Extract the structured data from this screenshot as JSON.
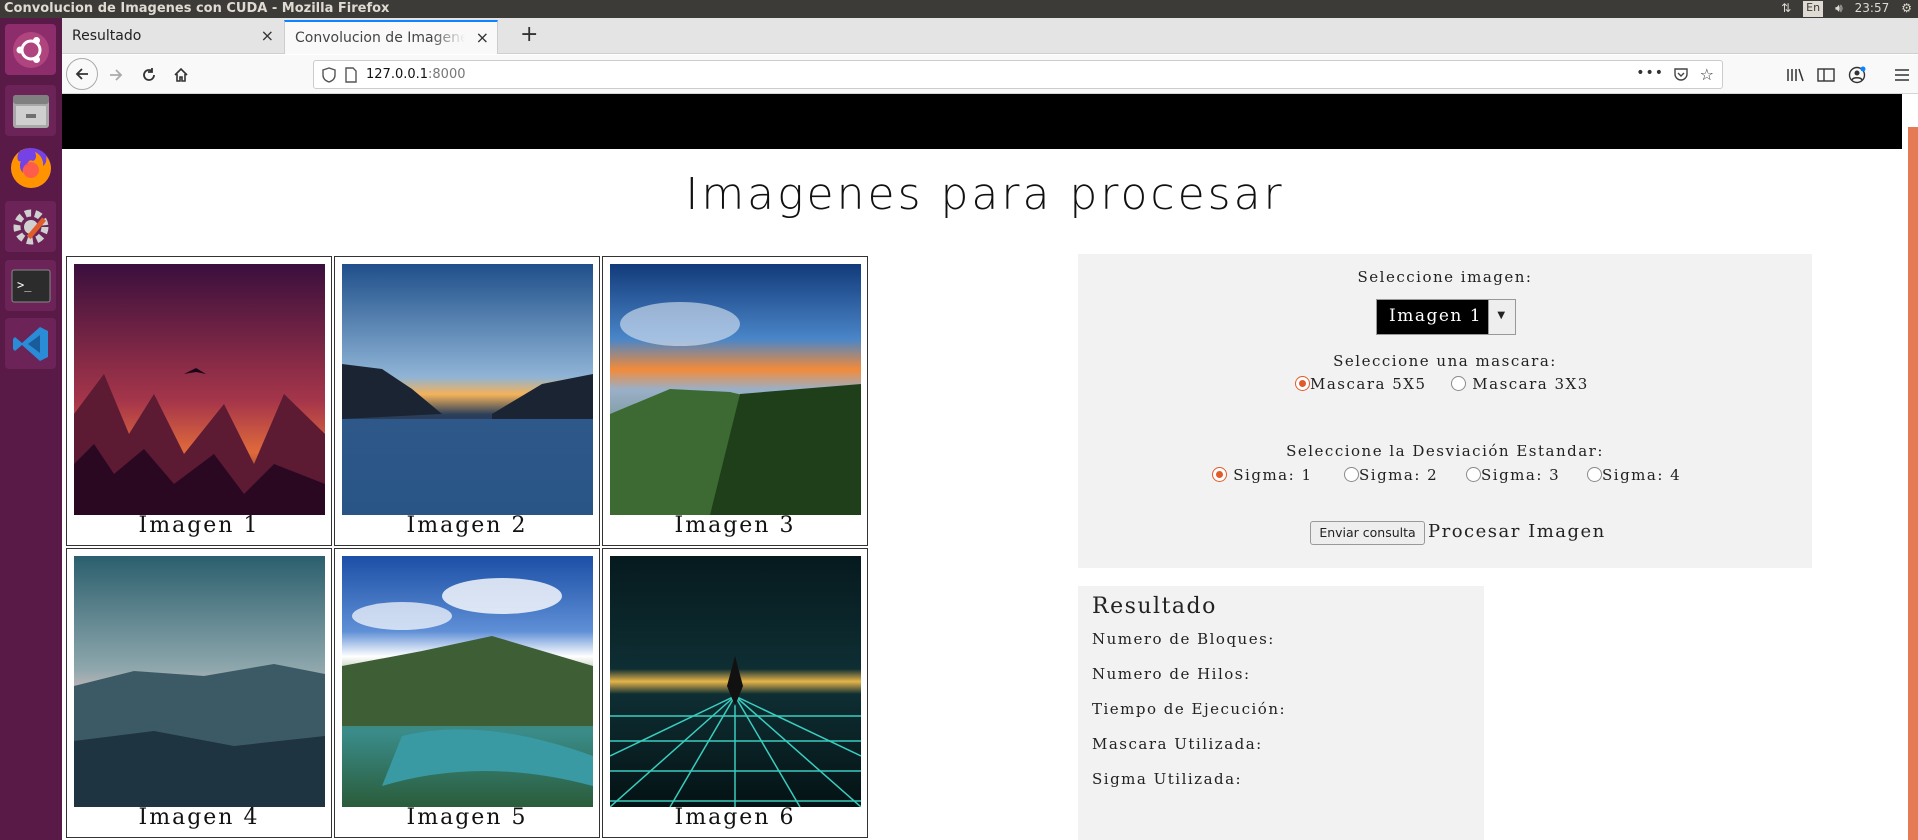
{
  "window": {
    "title": "Convolucion de Imagenes con CUDA - Mozilla Firefox",
    "keyboard_layout": "En",
    "clock": "23:57"
  },
  "launcher": {
    "items": [
      "ubuntu-icon",
      "files-icon",
      "firefox-icon",
      "settings-icon",
      "terminal-icon",
      "vscode-icon"
    ]
  },
  "tabs": [
    {
      "label": "Resultado",
      "active": false
    },
    {
      "label": "Convolucion de Imagenes con CUDA",
      "active": true
    }
  ],
  "navbar": {
    "url_host": "127.0.0.1",
    "url_port": ":8000"
  },
  "page": {
    "title": "Imagenes para procesar",
    "images": [
      {
        "caption": "Imagen 1"
      },
      {
        "caption": "Imagen 2"
      },
      {
        "caption": "Imagen 3"
      },
      {
        "caption": "Imagen 4"
      },
      {
        "caption": "Imagen 5"
      },
      {
        "caption": "Imagen 6"
      }
    ]
  },
  "form": {
    "select_label": "Seleccione imagen:",
    "select_value": "Imagen 1",
    "mask_label": "Seleccione una mascara:",
    "mask_options": [
      {
        "label": "Mascara 5X5",
        "checked": true
      },
      {
        "label": "Mascara 3X3",
        "checked": false
      }
    ],
    "sigma_label": "Seleccione la Desviación Estandar:",
    "sigma_options": [
      {
        "label": "Sigma: 1",
        "checked": true
      },
      {
        "label": "Sigma: 2",
        "checked": false
      },
      {
        "label": "Sigma: 3",
        "checked": false
      },
      {
        "label": "Sigma: 4",
        "checked": false
      }
    ],
    "submit_label": "Enviar consulta",
    "submit_text": "Procesar Imagen"
  },
  "result": {
    "heading": "Resultado",
    "rows": [
      "Numero de Bloques:",
      "Numero de Hilos:",
      "Tiempo de Ejecución:",
      "Mascara Utilizada:",
      "Sigma Utilizada:"
    ]
  },
  "colors": {
    "launcher_bg": "#5a1a48",
    "radio_checked": "#e05c2a",
    "accent_bar": "#e57b54"
  }
}
